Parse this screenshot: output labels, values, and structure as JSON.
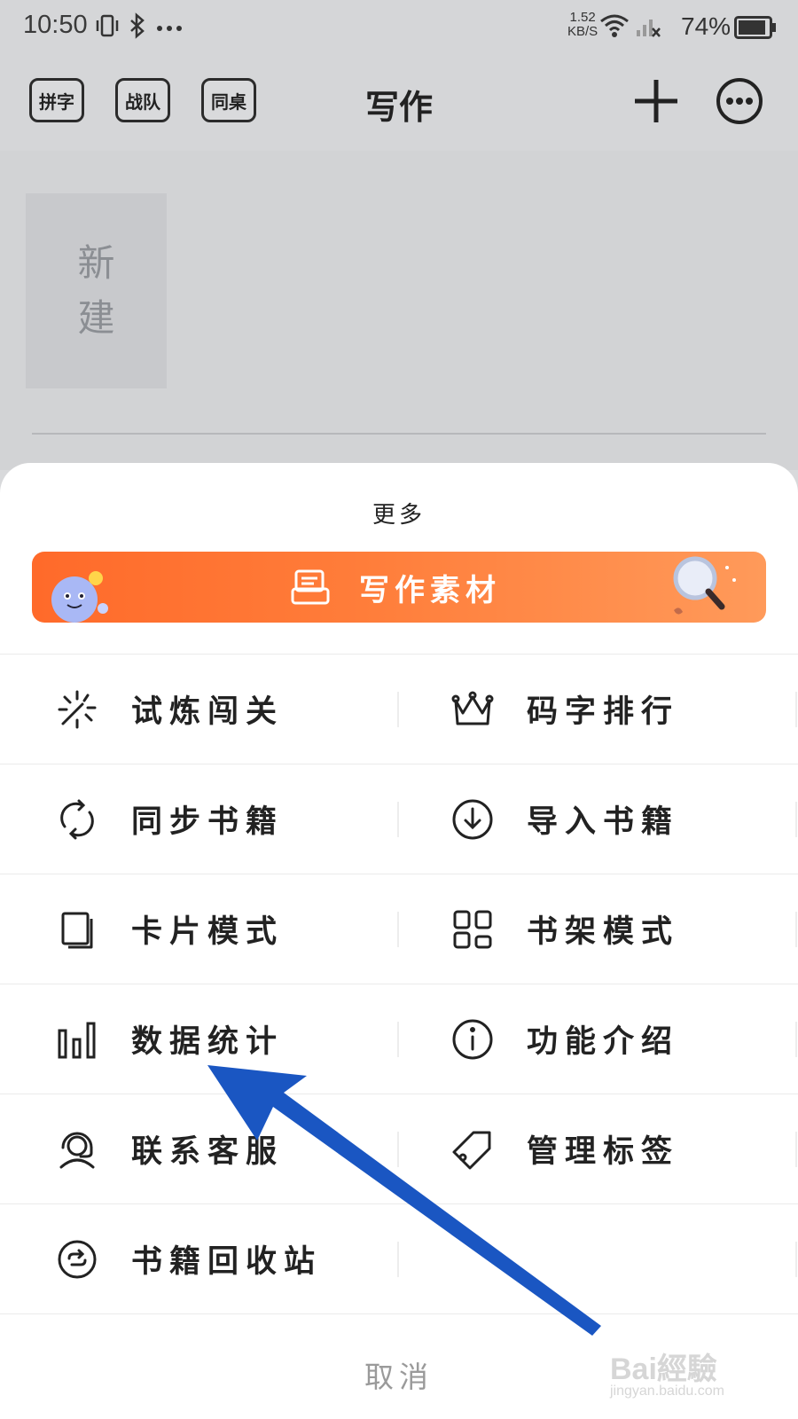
{
  "status_bar": {
    "time": "10:50",
    "net_speed_value": "1.52",
    "net_speed_unit": "KB/S",
    "battery": "74%"
  },
  "header": {
    "chips": [
      "拼字",
      "战队",
      "同桌"
    ],
    "title": "写作"
  },
  "content": {
    "new_card_line1": "新",
    "new_card_line2": "建"
  },
  "sheet": {
    "title": "更多",
    "banner_label": "写作素材",
    "items": [
      {
        "label": "试炼闯关",
        "icon": "sparkle-icon"
      },
      {
        "label": "码字排行",
        "icon": "crown-icon"
      },
      {
        "label": "同步书籍",
        "icon": "sync-icon"
      },
      {
        "label": "导入书籍",
        "icon": "download-circle-icon"
      },
      {
        "label": "卡片模式",
        "icon": "cards-icon"
      },
      {
        "label": "书架模式",
        "icon": "grid-icon"
      },
      {
        "label": "数据统计",
        "icon": "bar-chart-icon"
      },
      {
        "label": "功能介绍",
        "icon": "info-icon"
      },
      {
        "label": "联系客服",
        "icon": "headset-icon"
      },
      {
        "label": "管理标签",
        "icon": "tag-icon"
      },
      {
        "label": "书籍回收站",
        "icon": "recycle-icon"
      }
    ],
    "cancel": "取消"
  },
  "watermark": {
    "brand": "Bai經驗",
    "url": "jingyan.baidu.com"
  },
  "colors": {
    "banner_start": "#ff6a2a",
    "banner_end": "#ff9a5a",
    "arrow": "#1a56c2"
  }
}
